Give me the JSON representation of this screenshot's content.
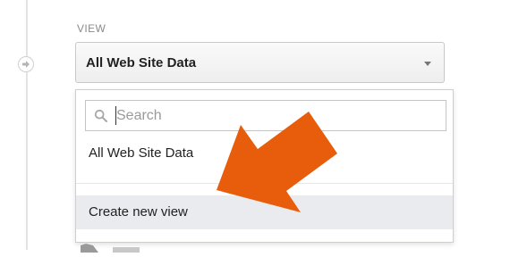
{
  "section": {
    "label": "VIEW"
  },
  "view_select": {
    "value": "All Web Site Data",
    "icon": "chevron-down-icon"
  },
  "dropdown": {
    "search": {
      "placeholder": "Search",
      "value": "",
      "icon": "search-icon"
    },
    "items": [
      {
        "label": "All Web Site Data"
      },
      {
        "label": "Create new view",
        "highlighted": true
      }
    ]
  },
  "colors": {
    "callout_arrow": "#e85d0c",
    "highlight_row": "#e9ebee",
    "label_gray": "#8a8a8a"
  }
}
